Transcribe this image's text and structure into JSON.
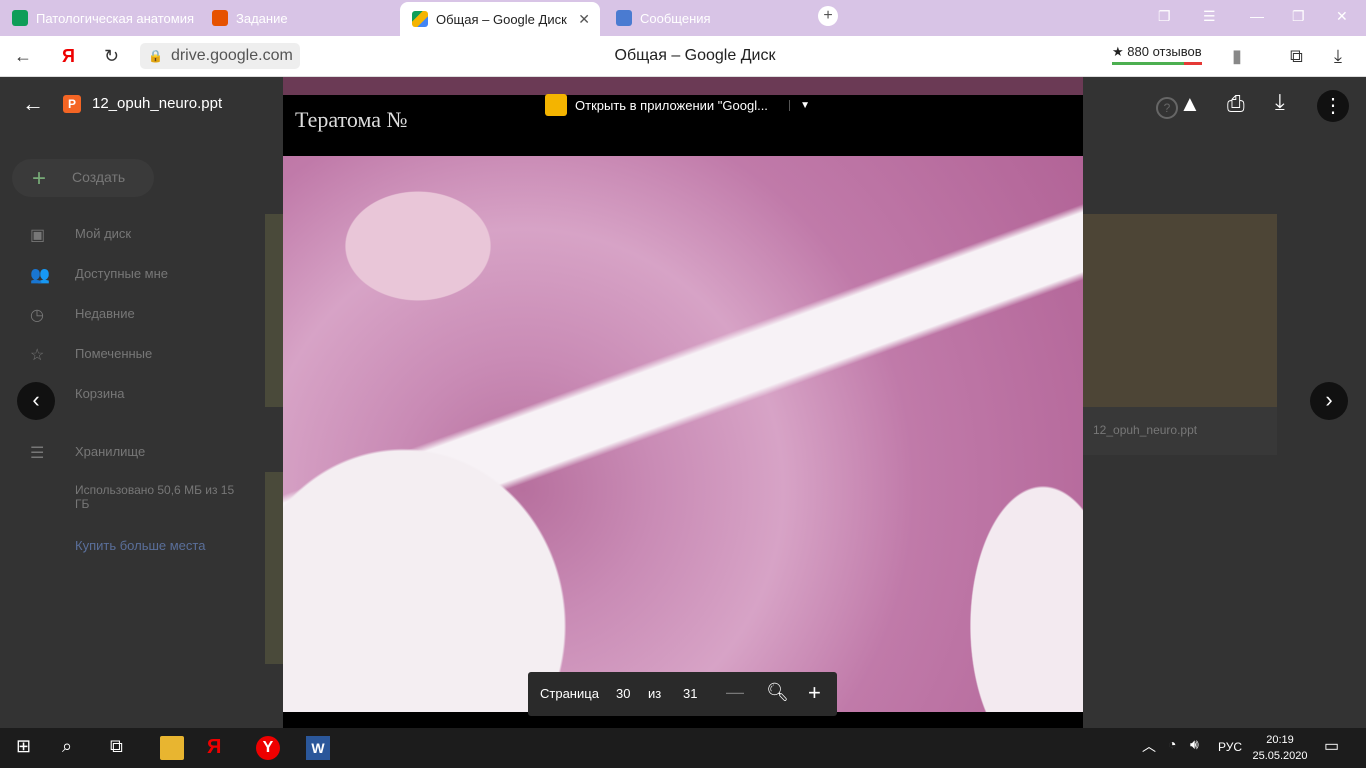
{
  "browser": {
    "tabs": [
      {
        "title": "Патологическая анатомия",
        "color": "#0f9d58"
      },
      {
        "title": "Задание",
        "color": "#e65100"
      },
      {
        "title": "Общая – Google Диск",
        "color": "#4285f4"
      },
      {
        "title": "Сообщения",
        "color": "#4a7bd1"
      }
    ],
    "url": "drive.google.com",
    "page_title": "Общая – Google Диск",
    "reviews": "★ 880 отзывов"
  },
  "drive_bg": {
    "create_label": "Создать",
    "sidebar": [
      "Мой диск",
      "Доступные мне",
      "Недавние",
      "Помеченные",
      "Корзина"
    ],
    "storage_label": "Хранилище",
    "usage": "Использовано 50,6 МБ из 15 ГБ",
    "buy_more": "Купить больше места",
    "file_label": "12_opuh_neuro.ppt"
  },
  "viewer": {
    "file_name": "12_opuh_neuro.ppt",
    "file_badge": "P",
    "open_in_app": "Открыть в приложении \"Googl...",
    "slide_title": "Тератома №",
    "page_label": "Страница",
    "page_current": "30",
    "page_of": "из",
    "page_total": "31"
  },
  "taskbar": {
    "lang": "РУС",
    "time": "20:19",
    "date": "25.05.2020"
  }
}
